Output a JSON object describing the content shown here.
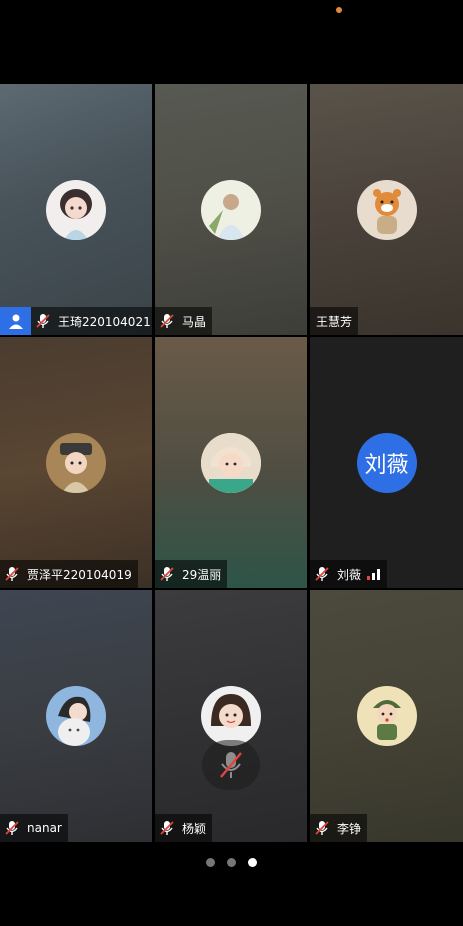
{
  "tiles": [
    {
      "name": "王琦220104021",
      "muted": true,
      "host": true,
      "avatar": "cartoon-girl-avatar"
    },
    {
      "name": "马晶",
      "muted": true,
      "avatar": "illustration-avatar"
    },
    {
      "name": "王慧芳",
      "muted": false,
      "avatar": "tiger-avatar"
    },
    {
      "name": "贾泽平220104019",
      "muted": true,
      "avatar": "cartoon-character-avatar"
    },
    {
      "name": "29温丽",
      "muted": true,
      "avatar": "baby-avatar"
    },
    {
      "name": "刘薇",
      "muted": true,
      "avatar_text": "刘薇",
      "speaking": true
    },
    {
      "name": "nanar",
      "muted": true,
      "avatar": "girl-with-cat-avatar"
    },
    {
      "name": "杨颖",
      "muted": true,
      "avatar": "girl-photo-avatar"
    },
    {
      "name": "李铮",
      "muted": true,
      "avatar": "soldier-cartoon-avatar"
    }
  ],
  "pager": {
    "count": 3,
    "active": 2
  },
  "colors": {
    "accent": "#2f6fe6",
    "muted_red": "#e0463c",
    "signal": "#e0463c"
  }
}
